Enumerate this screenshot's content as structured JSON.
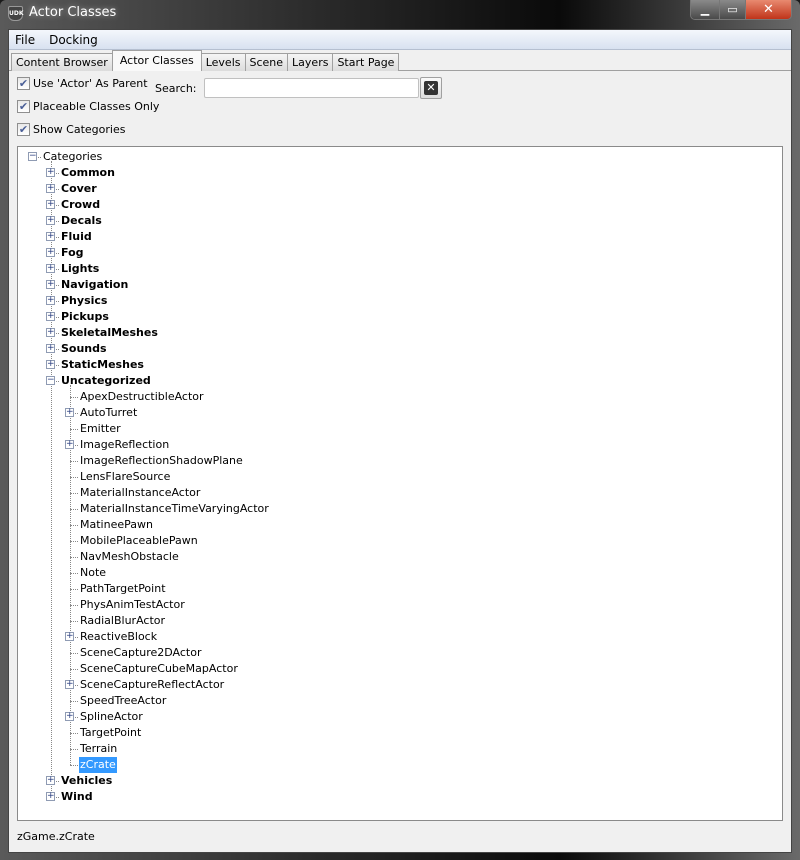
{
  "window": {
    "title": "Actor Classes",
    "app_icon": "UDK"
  },
  "menu": [
    "File",
    "Docking"
  ],
  "tabs": [
    {
      "label": "Content Browser"
    },
    {
      "label": "Actor Classes",
      "active": true
    },
    {
      "label": "Levels"
    },
    {
      "label": "Scene"
    },
    {
      "label": "Layers"
    },
    {
      "label": "Start Page"
    }
  ],
  "options": {
    "use_actor_parent": "Use 'Actor' As Parent",
    "placeable_only": "Placeable Classes Only",
    "show_categories": "Show Categories"
  },
  "search": {
    "label": "Search:",
    "value": ""
  },
  "tree": {
    "root": "Categories",
    "categories": [
      {
        "label": "Common"
      },
      {
        "label": "Cover"
      },
      {
        "label": "Crowd"
      },
      {
        "label": "Decals"
      },
      {
        "label": "Fluid"
      },
      {
        "label": "Fog"
      },
      {
        "label": "Lights"
      },
      {
        "label": "Navigation"
      },
      {
        "label": "Physics"
      },
      {
        "label": "Pickups"
      },
      {
        "label": "SkeletalMeshes"
      },
      {
        "label": "Sounds"
      },
      {
        "label": "StaticMeshes"
      },
      {
        "label": "Uncategorized",
        "expanded": true,
        "children": [
          {
            "label": "ApexDestructibleActor"
          },
          {
            "label": "AutoTurret",
            "expandable": true
          },
          {
            "label": "Emitter"
          },
          {
            "label": "ImageReflection",
            "expandable": true
          },
          {
            "label": "ImageReflectionShadowPlane"
          },
          {
            "label": "LensFlareSource"
          },
          {
            "label": "MaterialInstanceActor"
          },
          {
            "label": "MaterialInstanceTimeVaryingActor"
          },
          {
            "label": "MatineePawn"
          },
          {
            "label": "MobilePlaceablePawn"
          },
          {
            "label": "NavMeshObstacle"
          },
          {
            "label": "Note"
          },
          {
            "label": "PathTargetPoint"
          },
          {
            "label": "PhysAnimTestActor"
          },
          {
            "label": "RadialBlurActor"
          },
          {
            "label": "ReactiveBlock",
            "expandable": true
          },
          {
            "label": "SceneCapture2DActor"
          },
          {
            "label": "SceneCaptureCubeMapActor"
          },
          {
            "label": "SceneCaptureReflectActor",
            "expandable": true
          },
          {
            "label": "SpeedTreeActor"
          },
          {
            "label": "SplineActor",
            "expandable": true
          },
          {
            "label": "TargetPoint"
          },
          {
            "label": "Terrain"
          },
          {
            "label": "zCrate",
            "selected": true
          }
        ]
      },
      {
        "label": "Vehicles"
      },
      {
        "label": "Wind"
      }
    ]
  },
  "status": "zGame.zCrate"
}
